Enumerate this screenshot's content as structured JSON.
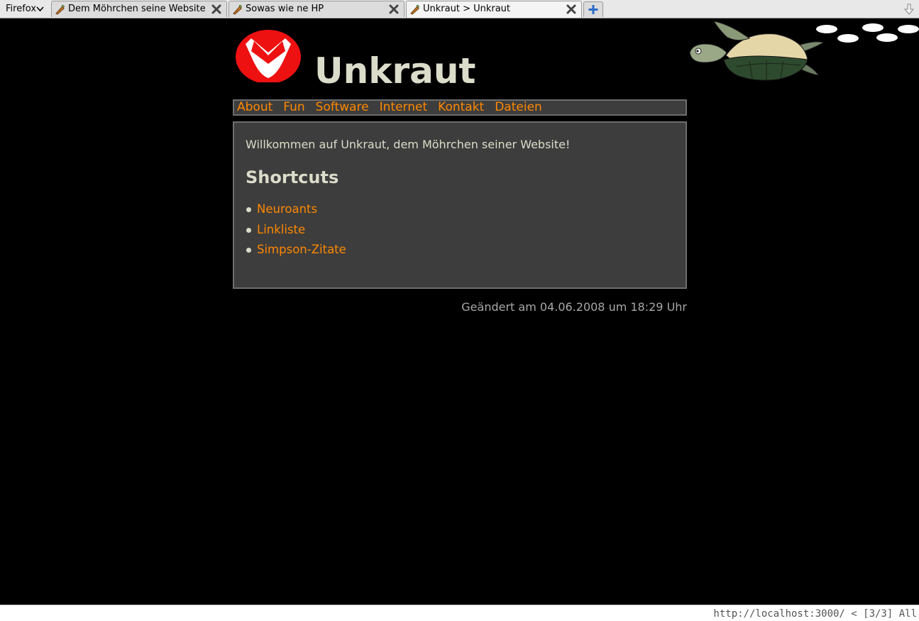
{
  "browser": {
    "menu_label": "Firefox",
    "tabs": [
      {
        "label": "Dem Möhrchen seine Website",
        "active": false
      },
      {
        "label": "Sowas wie ne HP",
        "active": false
      },
      {
        "label": "Unkraut > Unkraut",
        "active": true
      }
    ],
    "status_text": "http://localhost:3000/ < [3/3] All"
  },
  "page": {
    "title": "Unkraut",
    "nav": [
      "About",
      "Fun",
      "Software",
      "Internet",
      "Kontakt",
      "Dateien"
    ],
    "welcome": "Willkommen auf Unkraut, dem Möhrchen seiner Website!",
    "shortcuts_heading": "Shortcuts",
    "shortcuts": [
      "Neuroants",
      "Linkliste",
      "Simpson-Zitate"
    ],
    "changed": "Geändert am 04.06.2008 um 18:29 Uhr"
  },
  "colors": {
    "background": "#000000",
    "panel": "#3d3d3d",
    "panel_border": "#6e6e6e",
    "link": "#ff8800",
    "text": "#dcdccb",
    "logo_red": "#ee1111"
  }
}
